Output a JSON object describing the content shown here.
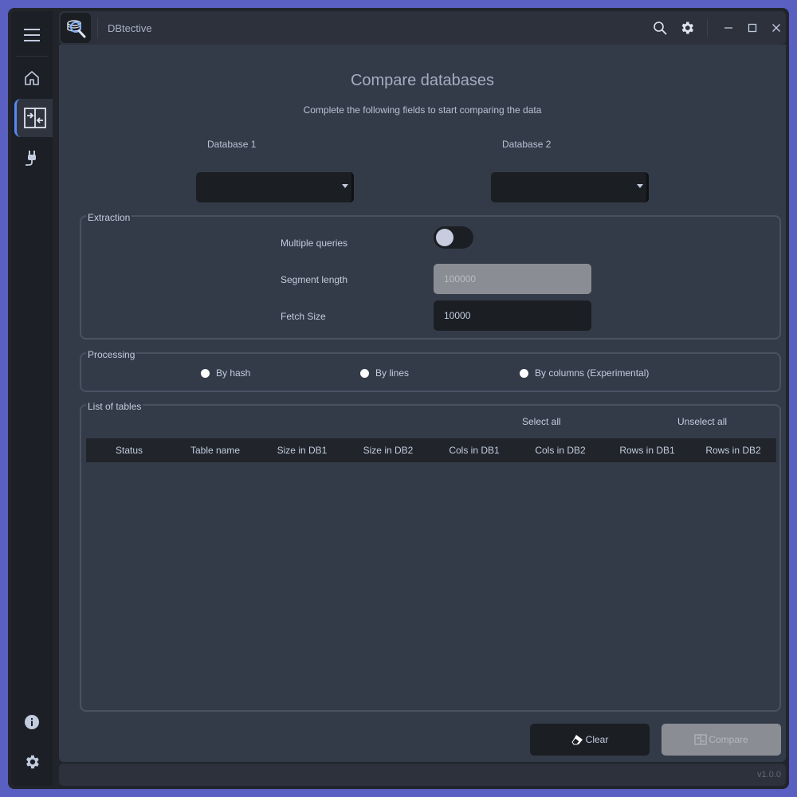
{
  "app": {
    "title": "DBtective"
  },
  "menu": {
    "items": [
      {
        "name": "hamburger-icon"
      },
      {
        "name": "home-icon"
      },
      {
        "name": "compare-icon",
        "active": true
      },
      {
        "name": "plug-icon"
      },
      {
        "name": "info-icon"
      },
      {
        "name": "settings-icon"
      }
    ]
  },
  "titlebar": {
    "icons": [
      "search-icon",
      "gear-icon",
      "minimize-icon",
      "maximize-icon",
      "close-icon"
    ]
  },
  "page": {
    "title": "Compare databases",
    "subtitle": "Complete the following fields to start comparing the data"
  },
  "databases": {
    "db1_label": "Database 1",
    "db1_value": "",
    "db2_label": "Database 2",
    "db2_value": ""
  },
  "extraction": {
    "title": "Extraction",
    "multiple_queries_label": "Multiple queries",
    "multiple_queries_on": false,
    "segment_length_label": "Segment length",
    "segment_length_value": "100000",
    "fetch_size_label": "Fetch Size",
    "fetch_size_value": "10000"
  },
  "processing": {
    "title": "Processing",
    "options": [
      "By hash",
      "By lines",
      "By columns (Experimental)"
    ]
  },
  "tables": {
    "title": "List of tables",
    "select_all": "Select all",
    "unselect_all": "Unselect all",
    "columns": [
      "Status",
      "Table name",
      "Size in DB1",
      "Size in DB2",
      "Cols in DB1",
      "Cols in DB2",
      "Rows in DB1",
      "Rows in DB2"
    ],
    "rows": []
  },
  "actions": {
    "clear_label": "Clear",
    "compare_label": "Compare"
  },
  "status": {
    "version": "v1.0.0"
  },
  "colors": {
    "accent": "#568af2",
    "background": "#21252b",
    "content": "#343b48",
    "disabled": "#8a8d93"
  }
}
